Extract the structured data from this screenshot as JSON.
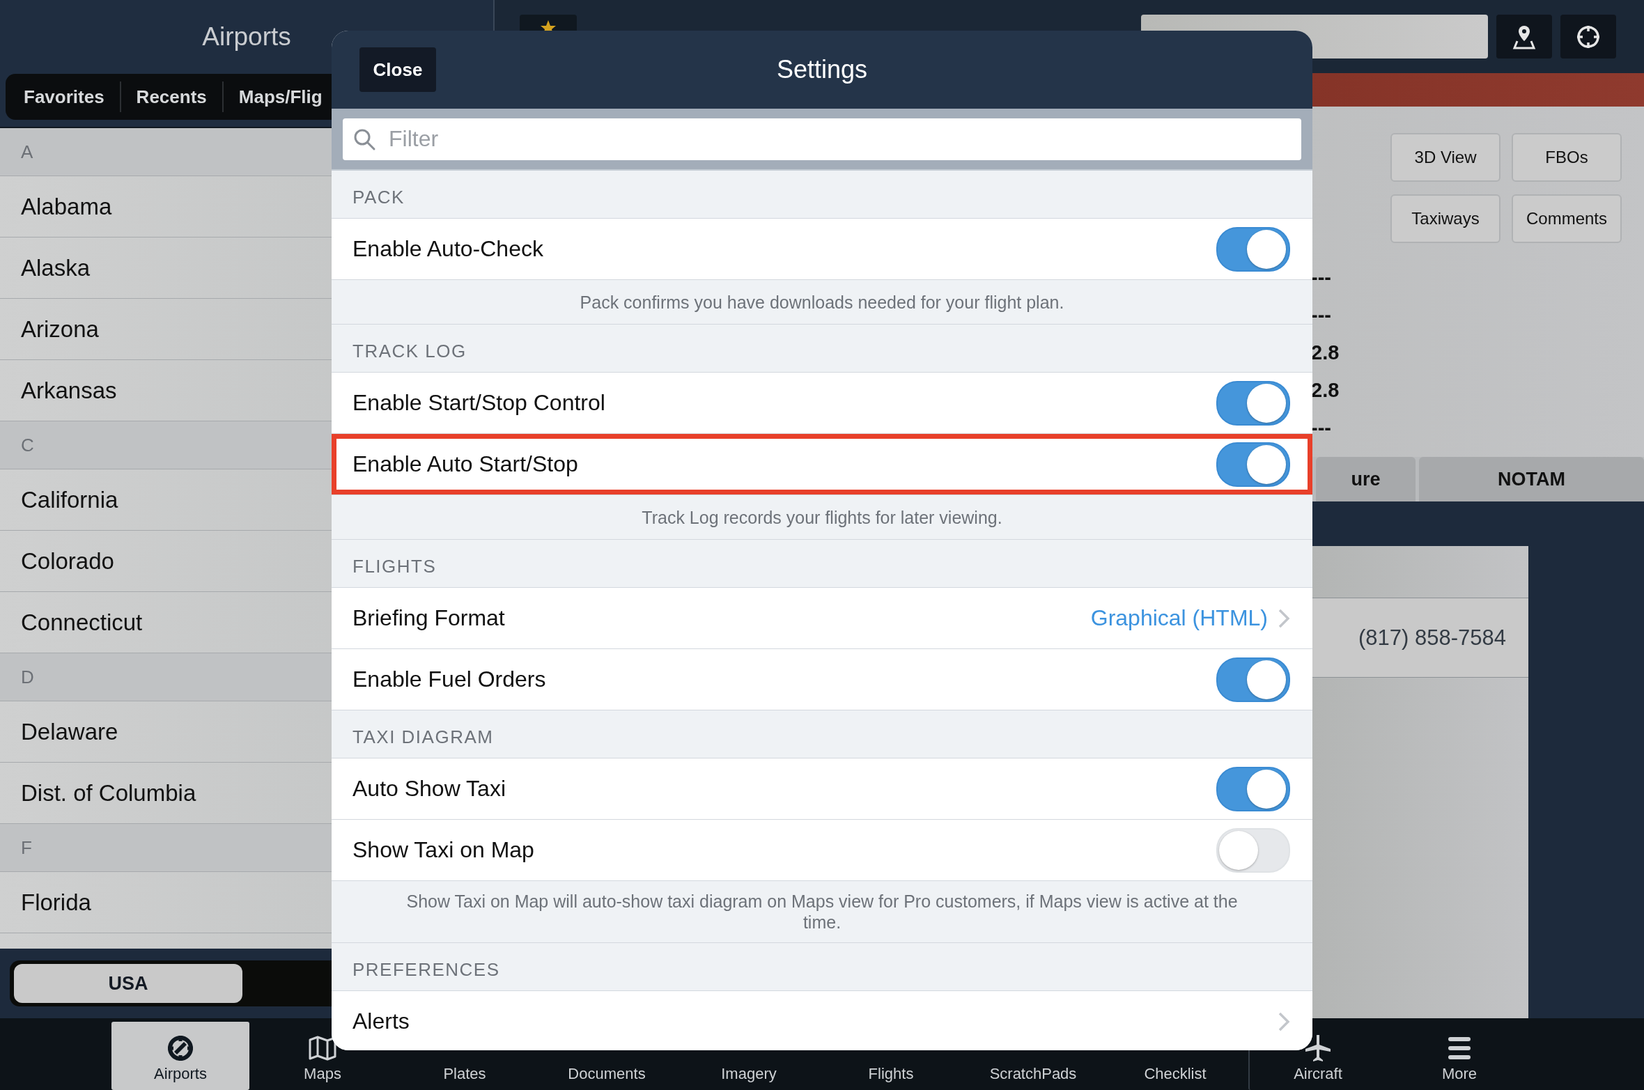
{
  "sidebar": {
    "title": "Airports",
    "tabs": [
      {
        "label": "Favorites",
        "selected": false
      },
      {
        "label": "Recents",
        "selected": false
      },
      {
        "label": "Maps/Flig",
        "selected": false
      }
    ],
    "sections": [
      {
        "letter": "A",
        "items": [
          "Alabama",
          "Alaska",
          "Arizona",
          "Arkansas"
        ]
      },
      {
        "letter": "C",
        "items": [
          "California",
          "Colorado",
          "Connecticut"
        ]
      },
      {
        "letter": "D",
        "items": [
          "Delaware",
          "Dist. of Columbia"
        ]
      },
      {
        "letter": "F",
        "items": [
          "Florida"
        ]
      }
    ],
    "region_button": "USA"
  },
  "detail": {
    "buttons": [
      "3D View",
      "FBOs",
      "Taxiways",
      "Comments"
    ],
    "values": [
      "---",
      "---",
      "2.8",
      "2.8",
      "---"
    ],
    "tabs": [
      {
        "label": "ure",
        "selected": false
      },
      {
        "label": "NOTAM",
        "selected": false
      }
    ],
    "phone": "(817) 858-7584"
  },
  "settings": {
    "close": "Close",
    "title": "Settings",
    "filter_placeholder": "Filter",
    "groups": [
      {
        "header": "PACK",
        "rows": [
          {
            "kind": "toggle",
            "label": "Enable Auto-Check",
            "on": true,
            "highlighted": false
          }
        ],
        "footer": "Pack confirms you have downloads needed for your flight plan."
      },
      {
        "header": "TRACK LOG",
        "rows": [
          {
            "kind": "toggle",
            "label": "Enable Start/Stop Control",
            "on": true,
            "highlighted": false
          },
          {
            "kind": "toggle",
            "label": "Enable Auto Start/Stop",
            "on": true,
            "highlighted": true
          }
        ],
        "footer": "Track Log records your flights for later viewing."
      },
      {
        "header": "FLIGHTS",
        "rows": [
          {
            "kind": "link",
            "label": "Briefing Format",
            "value": "Graphical (HTML)",
            "highlighted": false
          },
          {
            "kind": "toggle",
            "label": "Enable Fuel Orders",
            "on": true,
            "highlighted": false
          }
        ]
      },
      {
        "header": "TAXI DIAGRAM",
        "rows": [
          {
            "kind": "toggle",
            "label": "Auto Show Taxi",
            "on": true,
            "highlighted": false
          },
          {
            "kind": "toggle",
            "label": "Show Taxi on Map",
            "on": false,
            "highlighted": false
          }
        ],
        "footer": "Show Taxi on Map will auto-show taxi diagram on Maps view for Pro customers, if Maps view is active at the time."
      },
      {
        "header": "PREFERENCES",
        "rows": [
          {
            "kind": "link",
            "label": "Alerts",
            "highlighted": false
          }
        ]
      }
    ]
  },
  "tab_bar": [
    {
      "label": "Airports",
      "selected": true
    },
    {
      "label": "Maps",
      "selected": false
    },
    {
      "label": "Plates",
      "selected": false
    },
    {
      "label": "Documents",
      "selected": false
    },
    {
      "label": "Imagery",
      "selected": false
    },
    {
      "label": "Flights",
      "selected": false
    },
    {
      "label": "ScratchPads",
      "selected": false
    },
    {
      "label": "Checklist",
      "selected": false
    },
    {
      "label": "Aircraft",
      "selected": false
    },
    {
      "label": "More",
      "selected": false
    }
  ]
}
